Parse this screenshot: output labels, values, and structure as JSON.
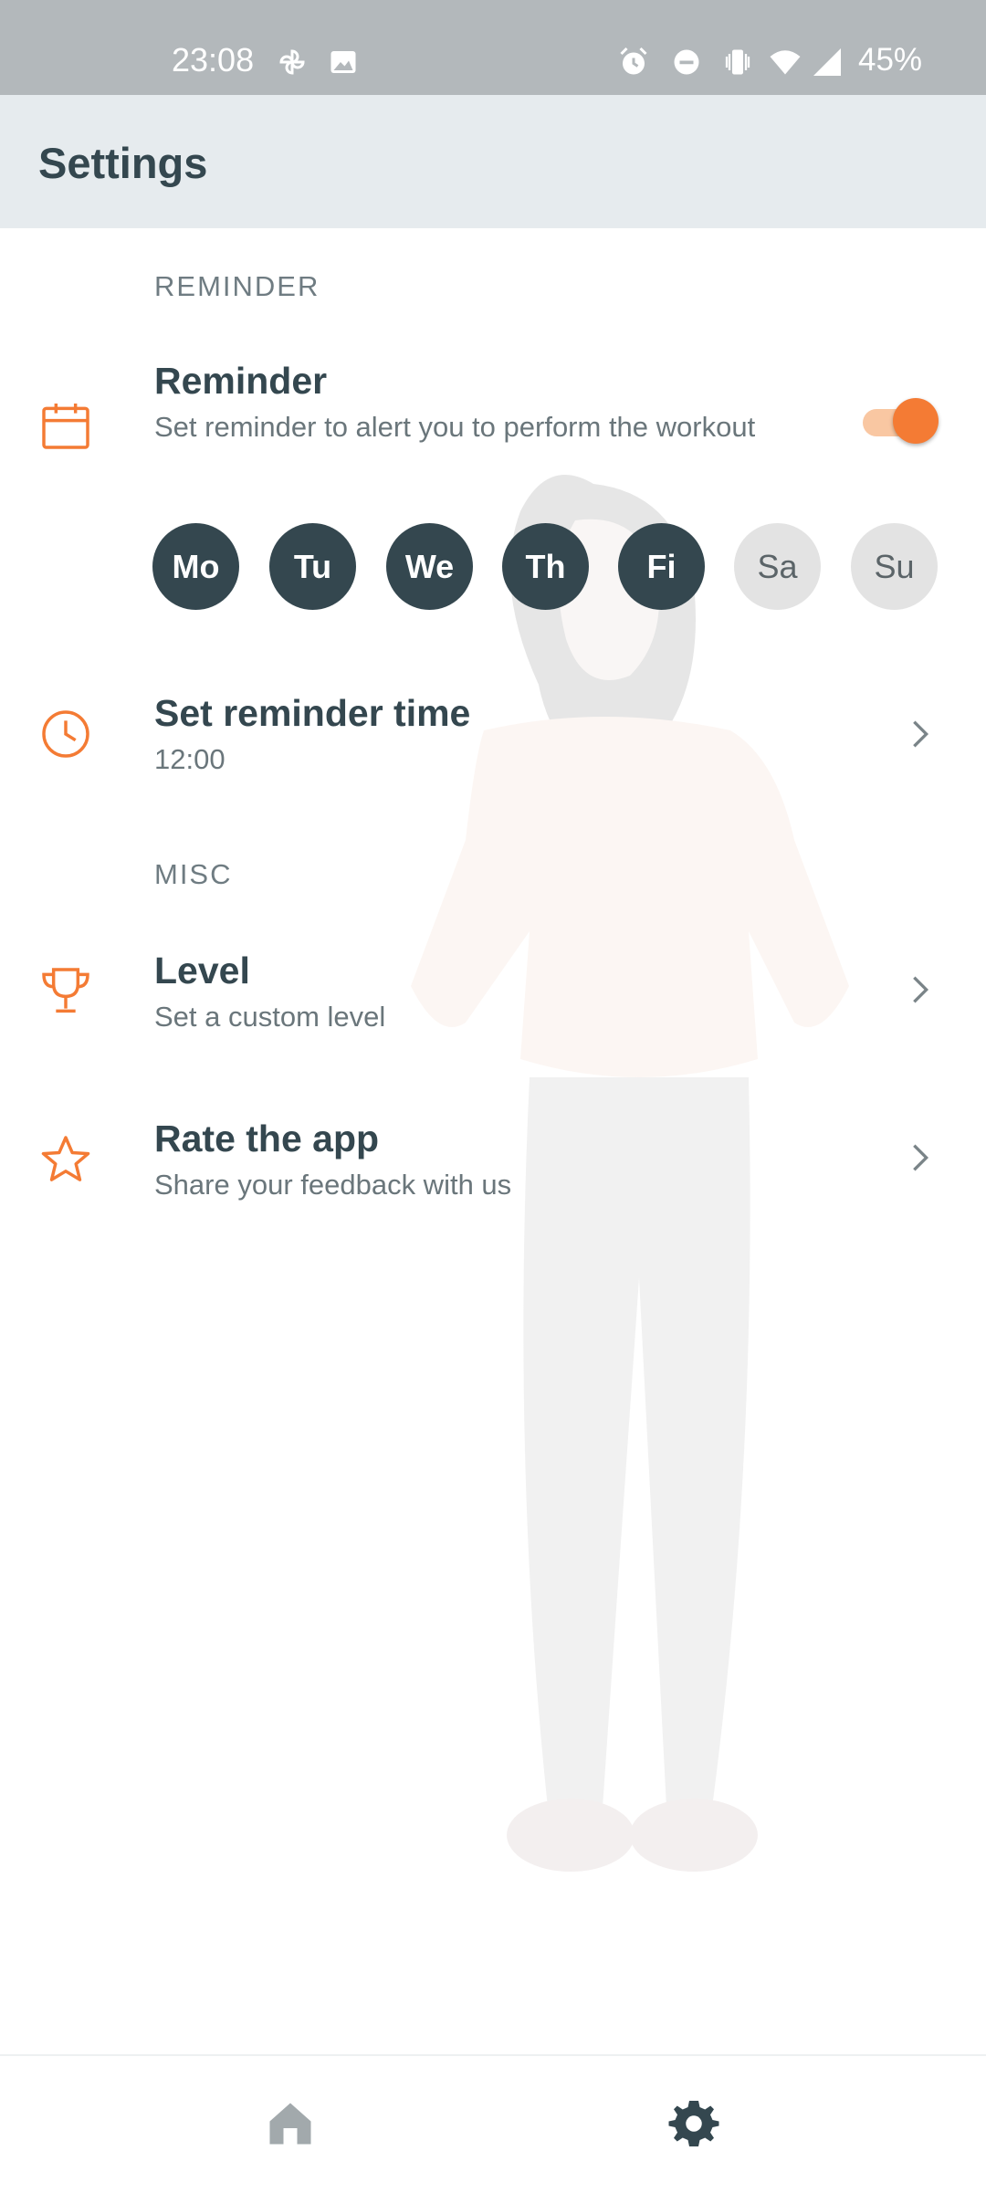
{
  "status_bar": {
    "time": "23:08",
    "battery": "45%",
    "icons": [
      "pinwheel-icon",
      "image-icon",
      "alarm-icon",
      "dnd-icon",
      "vibrate-icon",
      "wifi-icon",
      "signal-icon"
    ]
  },
  "header": {
    "title": "Settings"
  },
  "sections": {
    "reminder_header": "REMINDER",
    "misc_header": "MISC"
  },
  "reminder": {
    "title": "Reminder",
    "subtitle": "Set reminder to alert you to perform the workout",
    "enabled": true
  },
  "days": [
    {
      "label": "Mo",
      "selected": true
    },
    {
      "label": "Tu",
      "selected": true
    },
    {
      "label": "We",
      "selected": true
    },
    {
      "label": "Th",
      "selected": true
    },
    {
      "label": "Fi",
      "selected": true
    },
    {
      "label": "Sa",
      "selected": false
    },
    {
      "label": "Su",
      "selected": false
    }
  ],
  "reminder_time": {
    "title": "Set reminder time",
    "value": "12:00"
  },
  "level": {
    "title": "Level",
    "subtitle": "Set a custom level"
  },
  "rate": {
    "title": "Rate the app",
    "subtitle": "Share your feedback with us"
  },
  "colors": {
    "accent": "#f47b34",
    "text_dark": "#34474f",
    "app_bar": "#e6ebee",
    "status_bar": "#b3b8bb",
    "day_selected": "#34474f",
    "day_unselected": "#e3e3e3"
  },
  "bottom_nav": {
    "items": [
      "home-icon",
      "settings-gear-icon"
    ]
  }
}
